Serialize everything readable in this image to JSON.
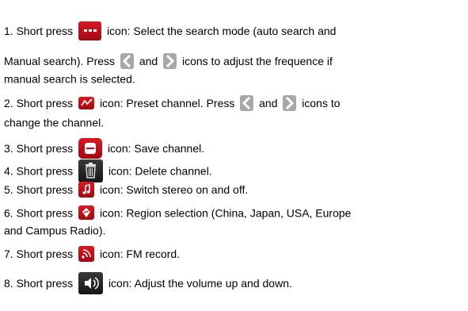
{
  "instructions": [
    {
      "id": 1,
      "prefix": "1. Short press",
      "icon": "more-dots-icon",
      "text": "icon: Select the search mode (auto search and",
      "continuation": [
        "Manual search). Press",
        "and",
        "icons to adjust the frequence if",
        "manual search is selected."
      ],
      "inline_icons": [
        "chevron-left-icon",
        "chevron-right-icon"
      ]
    },
    {
      "id": 2,
      "prefix": "2. Short press",
      "icon": "preset-channel-icon",
      "text": "icon: Preset channel. Press",
      "between": "and",
      "after": "icons to",
      "continuation": "change the channel.",
      "inline_icons": [
        "chevron-left-icon",
        "chevron-right-icon"
      ]
    },
    {
      "id": 3,
      "prefix": "3. Short press",
      "icon": "save-channel-icon",
      "text": "icon: Save channel."
    },
    {
      "id": 4,
      "prefix": "4. Short press",
      "icon": "delete-trash-icon",
      "text": "icon: Delete channel."
    },
    {
      "id": 5,
      "prefix": "5. Short press",
      "icon": "music-note-icon",
      "text": "icon: Switch stereo on and off."
    },
    {
      "id": 6,
      "prefix": "6. Short press",
      "icon": "region-icon",
      "text": "icon: Region selection (China, Japan, USA, Europe",
      "continuation": "and Campus Radio)."
    },
    {
      "id": 7,
      "prefix": "7. Short press",
      "icon": "fm-record-icon",
      "text": "icon: FM record."
    },
    {
      "id": 8,
      "prefix": "8. Short press",
      "icon": "volume-icon",
      "text": "icon: Adjust the volume up and down."
    }
  ],
  "colors": {
    "text": "#000000",
    "icon_dark": "#2b2b2b",
    "icon_red": "#c8101a",
    "chevron_gray": "#8a8a8a"
  }
}
